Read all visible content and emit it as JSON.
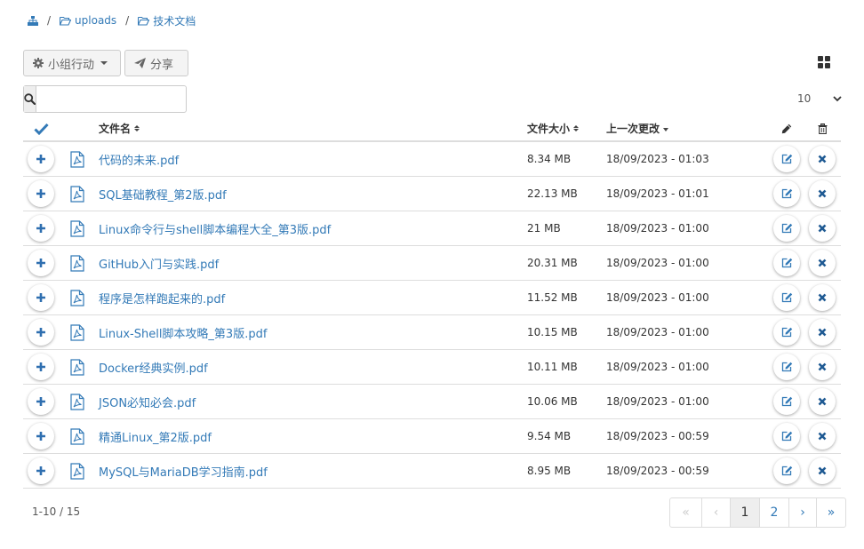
{
  "breadcrumb": {
    "items": [
      {
        "label": "uploads"
      },
      {
        "label": "技术文档"
      }
    ],
    "separator": "/"
  },
  "toolbar": {
    "group_action_label": "小组行动",
    "share_label": "分享"
  },
  "search": {
    "value": "",
    "placeholder": ""
  },
  "page_size": {
    "value": "10"
  },
  "table": {
    "columns": {
      "name": "文件名",
      "size": "文件大小",
      "modified": "上一次更改"
    },
    "rows": [
      {
        "name": "代码的未来.pdf",
        "size": "8.34 MB",
        "modified": "18/09/2023 - 01:03"
      },
      {
        "name": "SQL基础教程_第2版.pdf",
        "size": "22.13 MB",
        "modified": "18/09/2023 - 01:01"
      },
      {
        "name": "Linux命令行与shell脚本编程大全_第3版.pdf",
        "size": "21 MB",
        "modified": "18/09/2023 - 01:00"
      },
      {
        "name": "GitHub入门与实践.pdf",
        "size": "20.31 MB",
        "modified": "18/09/2023 - 01:00"
      },
      {
        "name": "程序是怎样跑起来的.pdf",
        "size": "11.52 MB",
        "modified": "18/09/2023 - 01:00"
      },
      {
        "name": "Linux-Shell脚本攻略_第3版.pdf",
        "size": "10.15 MB",
        "modified": "18/09/2023 - 01:00"
      },
      {
        "name": "Docker经典实例.pdf",
        "size": "10.11 MB",
        "modified": "18/09/2023 - 01:00"
      },
      {
        "name": "JSON必知必会.pdf",
        "size": "10.06 MB",
        "modified": "18/09/2023 - 01:00"
      },
      {
        "name": "精通Linux_第2版.pdf",
        "size": "9.54 MB",
        "modified": "18/09/2023 - 00:59"
      },
      {
        "name": "MySQL与MariaDB学习指南.pdf",
        "size": "8.95 MB",
        "modified": "18/09/2023 - 00:59"
      }
    ]
  },
  "footer": {
    "count": "1-10 / 15"
  },
  "pagination": {
    "first": "«",
    "prev": "‹",
    "pages": [
      "1",
      "2"
    ],
    "current": "1",
    "next": "›",
    "last": "»"
  },
  "colors": {
    "link": "#337ab7",
    "check": "#337ab7",
    "icon_blue": "#2f6fb0",
    "delete_icon": "#1f5a93",
    "border": "#dddddd"
  },
  "icons": {
    "breadcrumb_root": "sitemap-icon",
    "folder": "folder-open-icon",
    "group_action": "gear-icon",
    "share": "paper-plane-icon",
    "view": "grid-view-icon",
    "search": "search-icon",
    "select_all": "check-icon",
    "edit_column": "pencil-icon",
    "delete_column": "trash-icon",
    "row_expand": "plus-icon",
    "file": "file-pdf-icon",
    "row_edit": "edit-icon",
    "row_delete": "close-icon"
  }
}
